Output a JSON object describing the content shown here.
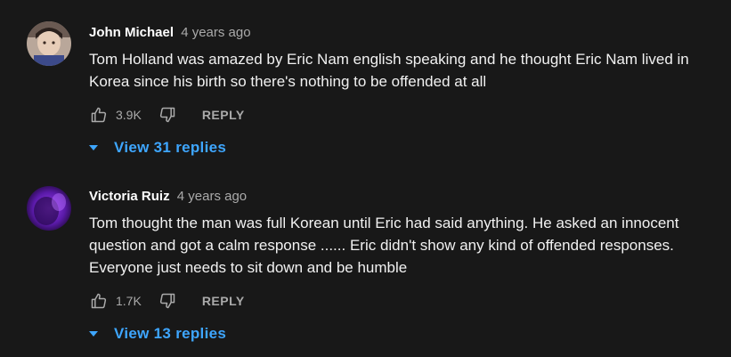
{
  "comments": [
    {
      "author": "John Michael",
      "time": "4 years ago",
      "text": "Tom Holland was amazed by Eric Nam english speaking and he thought Eric Nam lived in Korea since his birth so there's nothing to be offended at all",
      "likes": "3.9K",
      "reply_label": "REPLY",
      "replies_label": "View 31 replies",
      "avatar_icon": "user-avatar-photo"
    },
    {
      "author": "Victoria Ruiz",
      "time": "4 years ago",
      "text": "Tom thought the man was full Korean until Eric had said anything. He asked an innocent question and got a calm response ...... Eric didn't show any kind of offended responses. Everyone just needs to sit down and be humble",
      "likes": "1.7K",
      "reply_label": "REPLY",
      "replies_label": "View 13 replies",
      "avatar_icon": "user-avatar-photo"
    }
  ],
  "colors": {
    "background": "#181818",
    "link": "#3ea6ff",
    "secondary_text": "#aaaaaa"
  }
}
